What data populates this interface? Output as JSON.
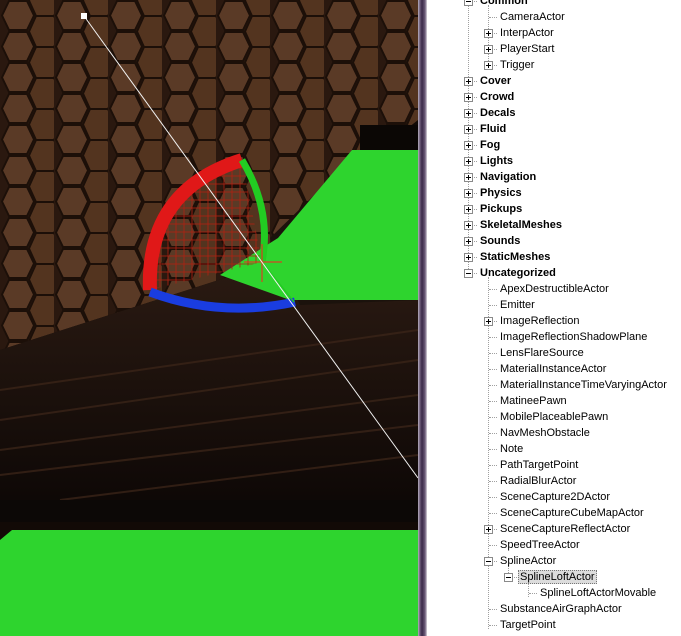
{
  "viewport": {
    "colors": {
      "hex_wall": "#5a3a26",
      "green_surface": "#2ed42e",
      "gizmo_red": "#e01818",
      "gizmo_green": "#22cc22",
      "gizmo_blue": "#1a3de0",
      "selection_line": "#f2f2f2"
    }
  },
  "tree": {
    "rows": [
      {
        "label": "Common",
        "bold": true,
        "expander": "minus"
      },
      {
        "label": "CameraActor",
        "bold": false,
        "expander": null
      },
      {
        "label": "InterpActor",
        "bold": false,
        "expander": "plus"
      },
      {
        "label": "PlayerStart",
        "bold": false,
        "expander": "plus"
      },
      {
        "label": "Trigger",
        "bold": false,
        "expander": "plus"
      },
      {
        "label": "Cover",
        "bold": true,
        "expander": "plus"
      },
      {
        "label": "Crowd",
        "bold": true,
        "expander": "plus"
      },
      {
        "label": "Decals",
        "bold": true,
        "expander": "plus"
      },
      {
        "label": "Fluid",
        "bold": true,
        "expander": "plus"
      },
      {
        "label": "Fog",
        "bold": true,
        "expander": "plus"
      },
      {
        "label": "Lights",
        "bold": true,
        "expander": "plus"
      },
      {
        "label": "Navigation",
        "bold": true,
        "expander": "plus"
      },
      {
        "label": "Physics",
        "bold": true,
        "expander": "plus"
      },
      {
        "label": "Pickups",
        "bold": true,
        "expander": "plus"
      },
      {
        "label": "SkeletalMeshes",
        "bold": true,
        "expander": "plus"
      },
      {
        "label": "Sounds",
        "bold": true,
        "expander": "plus"
      },
      {
        "label": "StaticMeshes",
        "bold": true,
        "expander": "plus"
      },
      {
        "label": "Uncategorized",
        "bold": true,
        "expander": "minus"
      },
      {
        "label": "ApexDestructibleActor",
        "bold": false,
        "expander": null
      },
      {
        "label": "Emitter",
        "bold": false,
        "expander": null
      },
      {
        "label": "ImageReflection",
        "bold": false,
        "expander": "plus"
      },
      {
        "label": "ImageReflectionShadowPlane",
        "bold": false,
        "expander": null
      },
      {
        "label": "LensFlareSource",
        "bold": false,
        "expander": null
      },
      {
        "label": "MaterialInstanceActor",
        "bold": false,
        "expander": null
      },
      {
        "label": "MaterialInstanceTimeVaryingActor",
        "bold": false,
        "expander": null
      },
      {
        "label": "MatineePawn",
        "bold": false,
        "expander": null
      },
      {
        "label": "MobilePlaceablePawn",
        "bold": false,
        "expander": null
      },
      {
        "label": "NavMeshObstacle",
        "bold": false,
        "expander": null
      },
      {
        "label": "Note",
        "bold": false,
        "expander": null
      },
      {
        "label": "PathTargetPoint",
        "bold": false,
        "expander": null
      },
      {
        "label": "RadialBlurActor",
        "bold": false,
        "expander": null
      },
      {
        "label": "SceneCapture2DActor",
        "bold": false,
        "expander": null
      },
      {
        "label": "SceneCaptureCubeMapActor",
        "bold": false,
        "expander": null
      },
      {
        "label": "SceneCaptureReflectActor",
        "bold": false,
        "expander": "plus"
      },
      {
        "label": "SpeedTreeActor",
        "bold": false,
        "expander": null
      },
      {
        "label": "SplineActor",
        "bold": false,
        "expander": "minus"
      },
      {
        "label": "SplineLoftActor",
        "bold": false,
        "expander": "minus",
        "selected": true
      },
      {
        "label": "SplineLoftActorMovable",
        "bold": false,
        "expander": null
      },
      {
        "label": "SubstanceAirGraphActor",
        "bold": false,
        "expander": null
      },
      {
        "label": "TargetPoint",
        "bold": false,
        "expander": null
      }
    ]
  }
}
